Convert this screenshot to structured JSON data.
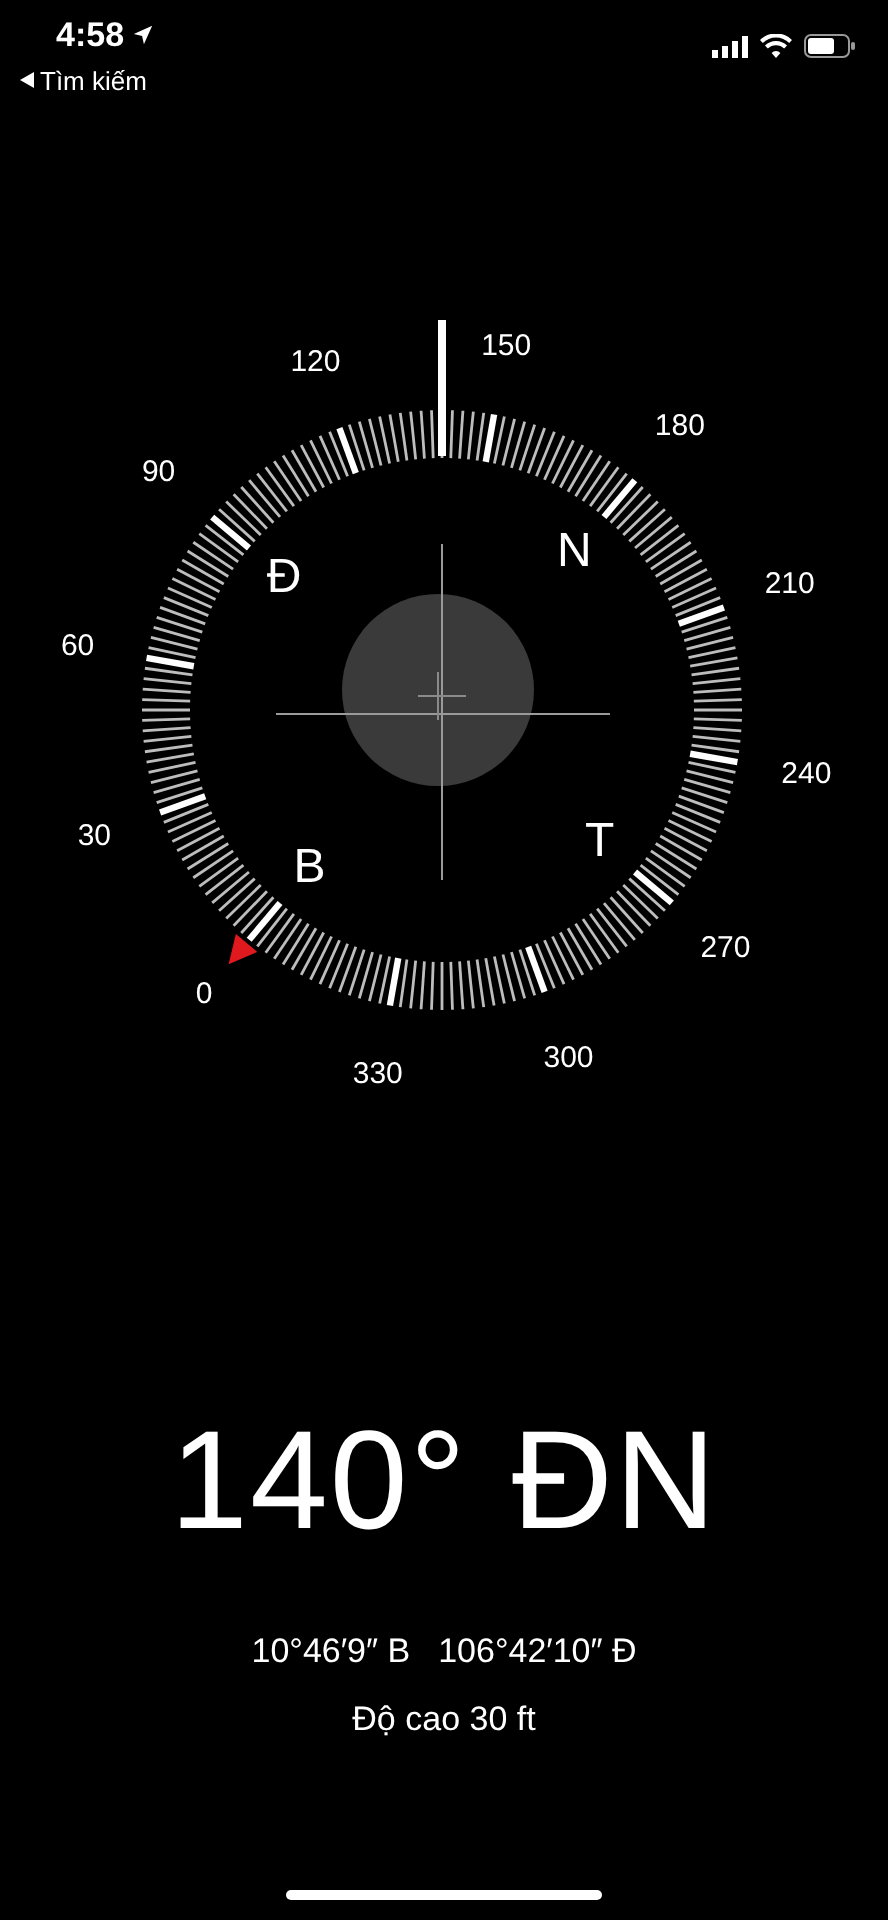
{
  "status_bar": {
    "time": "4:58",
    "back_label": "Tìm kiếm"
  },
  "compass": {
    "degree_labels": [
      "0",
      "30",
      "60",
      "90",
      "120",
      "150",
      "180",
      "210",
      "240",
      "270",
      "300",
      "330"
    ],
    "cardinal_labels": [
      {
        "kind": "east",
        "text": "Đ"
      },
      {
        "kind": "south",
        "text": "N"
      },
      {
        "kind": "north",
        "text": "B"
      },
      {
        "kind": "west",
        "text": "T"
      }
    ]
  },
  "heading": {
    "degrees": "140°",
    "direction": "ĐN"
  },
  "coordinates": [
    "10°46′9″ B",
    "106°42′10″ Đ"
  ],
  "altitude": "Độ cao 30 ft"
}
